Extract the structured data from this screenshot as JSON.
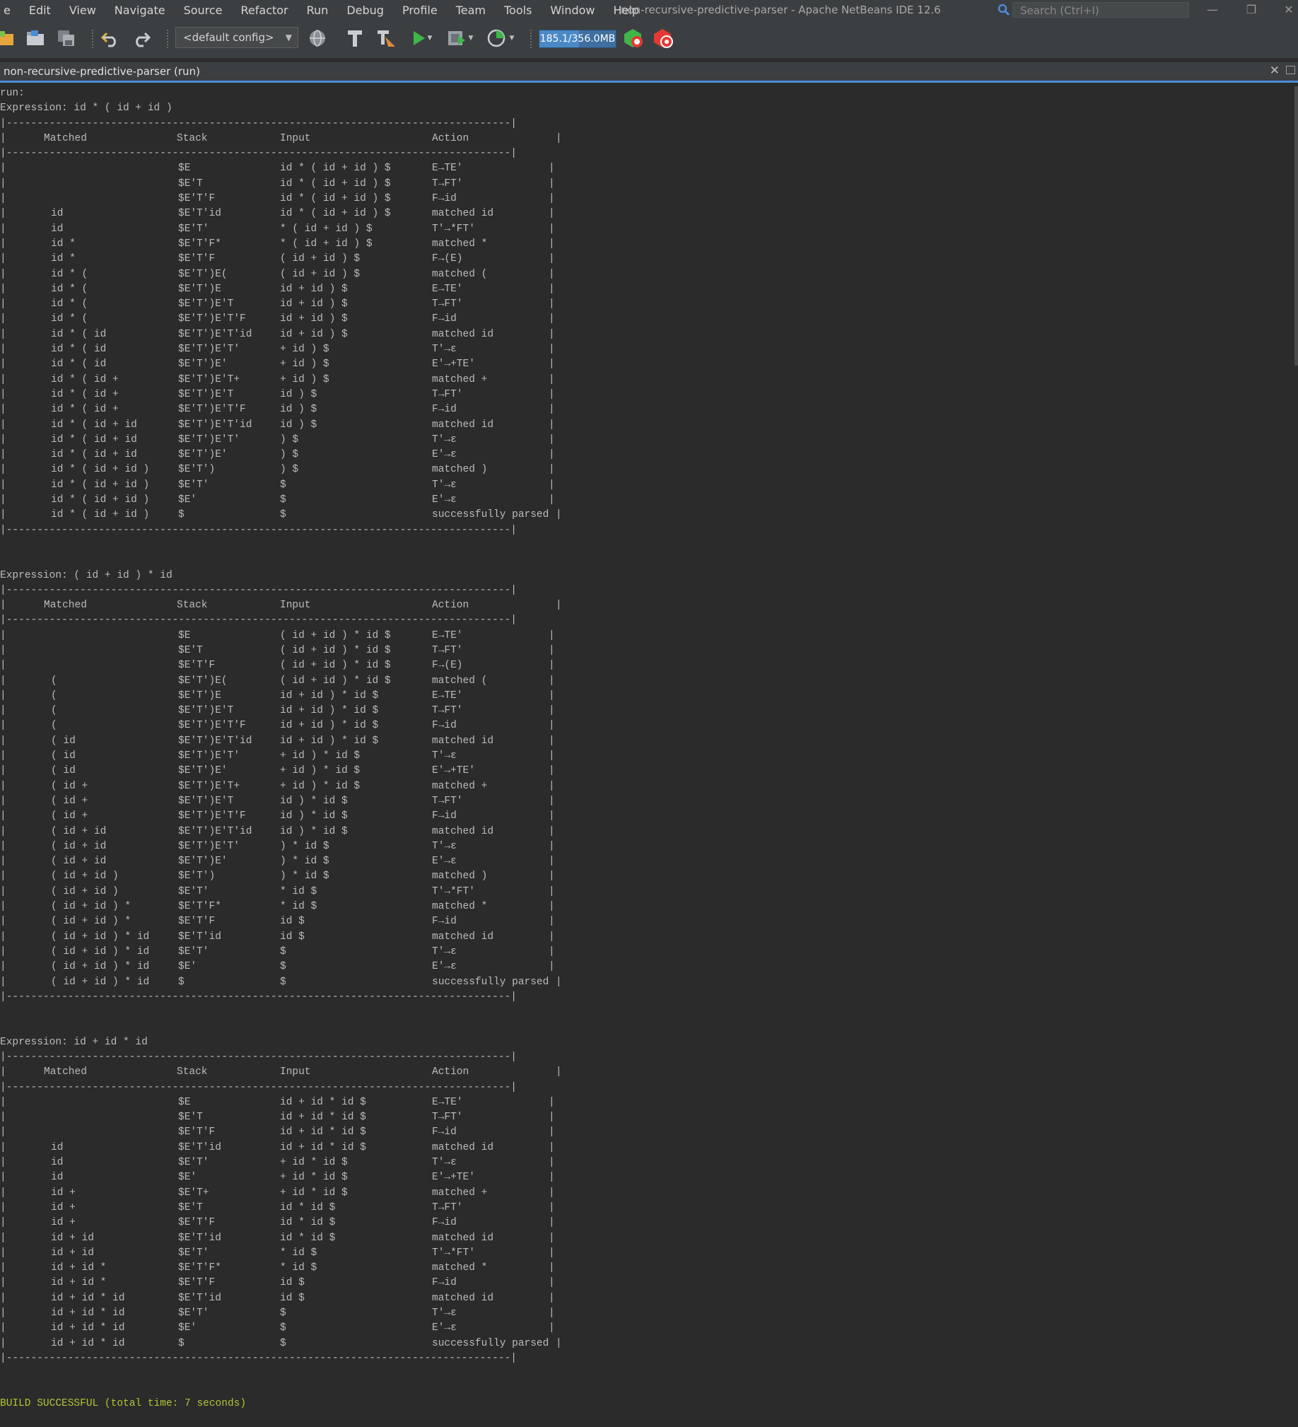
{
  "menu": [
    "e",
    "Edit",
    "View",
    "Navigate",
    "Source",
    "Refactor",
    "Run",
    "Debug",
    "Profile",
    "Team",
    "Tools",
    "Window",
    "Help"
  ],
  "window_title": "non-recursive-predictive-parser - Apache NetBeans IDE 12.6",
  "search": {
    "placeholder": "Search (Ctrl+I)"
  },
  "toolbar": {
    "config": "<default config>",
    "memory": "185.1/356.0MB",
    "memory_used_fraction": 0.52
  },
  "output_tab": {
    "label": "non-recursive-predictive-parser (run)"
  },
  "console": {
    "run_label": "run:",
    "build_message": "BUILD SUCCESSFUL (total time: 7 seconds)",
    "border_line": "|----------------------------------------------------------------------------------|",
    "header": {
      "matched": "Matched",
      "stack": "Stack",
      "input": "Input",
      "action": "Action"
    },
    "tables": [
      {
        "expression": "Expression: id * ( id + id )",
        "rows": [
          [
            "",
            "$E",
            "id * ( id + id ) $",
            "E→TE'"
          ],
          [
            "",
            "$E'T",
            "id * ( id + id ) $",
            "T→FT'"
          ],
          [
            "",
            "$E'T'F",
            "id * ( id + id ) $",
            "F→id"
          ],
          [
            "id",
            "$E'T'id",
            "id * ( id + id ) $",
            "matched id"
          ],
          [
            "id",
            "$E'T'",
            "* ( id + id ) $",
            "T'→*FT'"
          ],
          [
            "id *",
            "$E'T'F*",
            "* ( id + id ) $",
            "matched *"
          ],
          [
            "id *",
            "$E'T'F",
            "( id + id ) $",
            "F→(E)"
          ],
          [
            "id * (",
            "$E'T')E(",
            "( id + id ) $",
            "matched ("
          ],
          [
            "id * (",
            "$E'T')E",
            "id + id ) $",
            "E→TE'"
          ],
          [
            "id * (",
            "$E'T')E'T",
            "id + id ) $",
            "T→FT'"
          ],
          [
            "id * (",
            "$E'T')E'T'F",
            "id + id ) $",
            "F→id"
          ],
          [
            "id * ( id",
            "$E'T')E'T'id",
            "id + id ) $",
            "matched id"
          ],
          [
            "id * ( id",
            "$E'T')E'T'",
            "+ id ) $",
            "T'→ε"
          ],
          [
            "id * ( id",
            "$E'T')E'",
            "+ id ) $",
            "E'→+TE'"
          ],
          [
            "id * ( id +",
            "$E'T')E'T+",
            "+ id ) $",
            "matched +"
          ],
          [
            "id * ( id +",
            "$E'T')E'T",
            "id ) $",
            "T→FT'"
          ],
          [
            "id * ( id +",
            "$E'T')E'T'F",
            "id ) $",
            "F→id"
          ],
          [
            "id * ( id + id",
            "$E'T')E'T'id",
            "id ) $",
            "matched id"
          ],
          [
            "id * ( id + id",
            "$E'T')E'T'",
            ") $",
            "T'→ε"
          ],
          [
            "id * ( id + id",
            "$E'T')E'",
            ") $",
            "E'→ε"
          ],
          [
            "id * ( id + id )",
            "$E'T')",
            ") $",
            "matched )"
          ],
          [
            "id * ( id + id )",
            "$E'T'",
            "$",
            "T'→ε"
          ],
          [
            "id * ( id + id )",
            "$E'",
            "$",
            "E'→ε"
          ],
          [
            "id * ( id + id )",
            "$",
            "$",
            "successfully parsed"
          ]
        ]
      },
      {
        "expression": "Expression: ( id + id ) * id",
        "rows": [
          [
            "",
            "$E",
            "( id + id ) * id $",
            "E→TE'"
          ],
          [
            "",
            "$E'T",
            "( id + id ) * id $",
            "T→FT'"
          ],
          [
            "",
            "$E'T'F",
            "( id + id ) * id $",
            "F→(E)"
          ],
          [
            "(",
            "$E'T')E(",
            "( id + id ) * id $",
            "matched ("
          ],
          [
            "(",
            "$E'T')E",
            "id + id ) * id $",
            "E→TE'"
          ],
          [
            "(",
            "$E'T')E'T",
            "id + id ) * id $",
            "T→FT'"
          ],
          [
            "(",
            "$E'T')E'T'F",
            "id + id ) * id $",
            "F→id"
          ],
          [
            "( id",
            "$E'T')E'T'id",
            "id + id ) * id $",
            "matched id"
          ],
          [
            "( id",
            "$E'T')E'T'",
            "+ id ) * id $",
            "T'→ε"
          ],
          [
            "( id",
            "$E'T')E'",
            "+ id ) * id $",
            "E'→+TE'"
          ],
          [
            "( id +",
            "$E'T')E'T+",
            "+ id ) * id $",
            "matched +"
          ],
          [
            "( id +",
            "$E'T')E'T",
            "id ) * id $",
            "T→FT'"
          ],
          [
            "( id +",
            "$E'T')E'T'F",
            "id ) * id $",
            "F→id"
          ],
          [
            "( id + id",
            "$E'T')E'T'id",
            "id ) * id $",
            "matched id"
          ],
          [
            "( id + id",
            "$E'T')E'T'",
            ") * id $",
            "T'→ε"
          ],
          [
            "( id + id",
            "$E'T')E'",
            ") * id $",
            "E'→ε"
          ],
          [
            "( id + id )",
            "$E'T')",
            ") * id $",
            "matched )"
          ],
          [
            "( id + id )",
            "$E'T'",
            "* id $",
            "T'→*FT'"
          ],
          [
            "( id + id ) *",
            "$E'T'F*",
            "* id $",
            "matched *"
          ],
          [
            "( id + id ) *",
            "$E'T'F",
            "id $",
            "F→id"
          ],
          [
            "( id + id ) * id",
            "$E'T'id",
            "id $",
            "matched id"
          ],
          [
            "( id + id ) * id",
            "$E'T'",
            "$",
            "T'→ε"
          ],
          [
            "( id + id ) * id",
            "$E'",
            "$",
            "E'→ε"
          ],
          [
            "( id + id ) * id",
            "$",
            "$",
            "successfully parsed"
          ]
        ]
      },
      {
        "expression": "Expression: id + id * id",
        "rows": [
          [
            "",
            "$E",
            "id + id * id $",
            "E→TE'"
          ],
          [
            "",
            "$E'T",
            "id + id * id $",
            "T→FT'"
          ],
          [
            "",
            "$E'T'F",
            "id + id * id $",
            "F→id"
          ],
          [
            "id",
            "$E'T'id",
            "id + id * id $",
            "matched id"
          ],
          [
            "id",
            "$E'T'",
            "+ id * id $",
            "T'→ε"
          ],
          [
            "id",
            "$E'",
            "+ id * id $",
            "E'→+TE'"
          ],
          [
            "id +",
            "$E'T+",
            "+ id * id $",
            "matched +"
          ],
          [
            "id +",
            "$E'T",
            "id * id $",
            "T→FT'"
          ],
          [
            "id +",
            "$E'T'F",
            "id * id $",
            "F→id"
          ],
          [
            "id + id",
            "$E'T'id",
            "id * id $",
            "matched id"
          ],
          [
            "id + id",
            "$E'T'",
            "* id $",
            "T'→*FT'"
          ],
          [
            "id + id *",
            "$E'T'F*",
            "* id $",
            "matched *"
          ],
          [
            "id + id *",
            "$E'T'F",
            "id $",
            "F→id"
          ],
          [
            "id + id * id",
            "$E'T'id",
            "id $",
            "matched id"
          ],
          [
            "id + id * id",
            "$E'T'",
            "$",
            "T'→ε"
          ],
          [
            "id + id * id",
            "$E'",
            "$",
            "E'→ε"
          ],
          [
            "id + id * id",
            "$",
            "$",
            "successfully parsed"
          ]
        ]
      }
    ]
  }
}
